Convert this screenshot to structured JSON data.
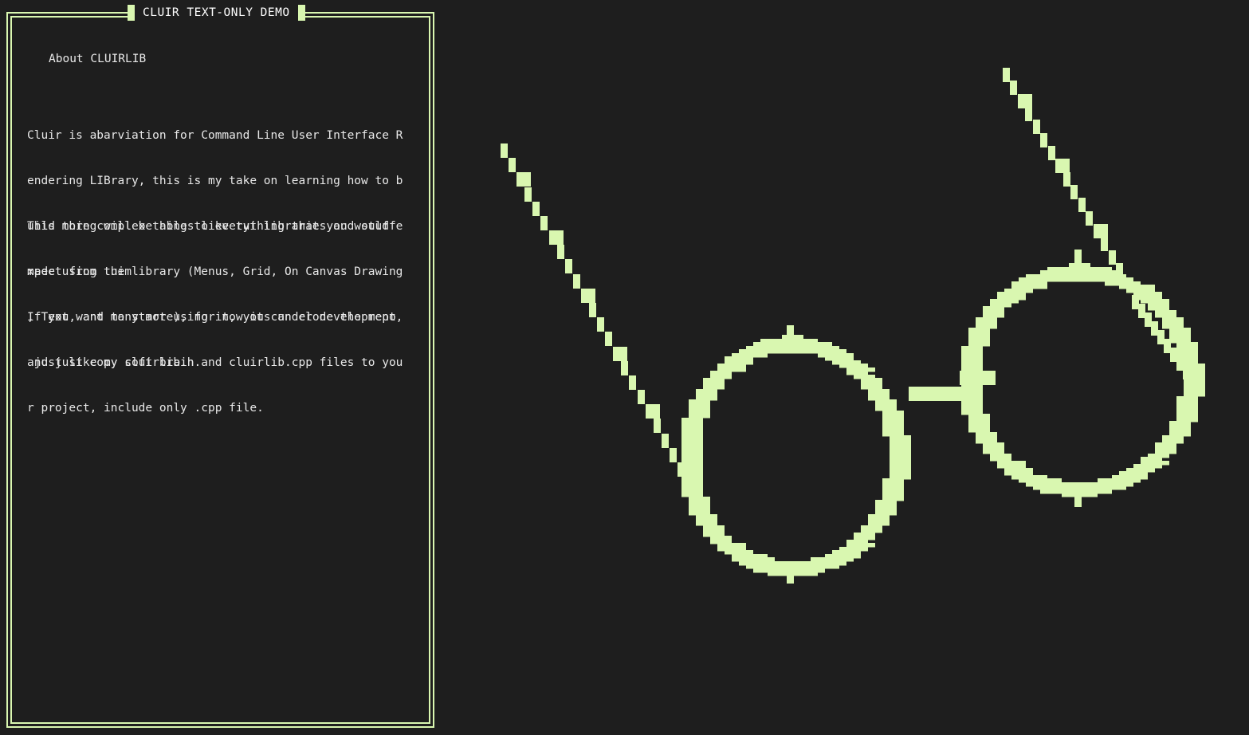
{
  "window": {
    "title": "CLUIR TEXT-ONLY DEMO"
  },
  "content": {
    "heading": "About CLUIRLIB",
    "paragraphs": [
      [
        "Cluir is abarviation for Command Line User Interface R",
        "endering LIBrary, this is my take on learning how to b",
        "uild more complex things like tui libraries and stuff",
        "made using them"
      ],
      [
        "This thing will be able to everything that you would e",
        "xpect from tui library (Menus, Grid, On Canvas Drawing",
        ", Text, and many more), for now its under development,",
        " just like my soft brain."
      ],
      [
        "If you want to start using it, you can clone the repo",
        "and just copy cluirlib.h and cluirlib.cpp files to you",
        "r project, include only .cpp file."
      ]
    ]
  },
  "canvas": {
    "drawing": "glasses-pixel-art",
    "color": "#d9f7b0"
  },
  "colors": {
    "background": "#1e1e1e",
    "accent": "#d9f7b0",
    "text": "#e8e8e8"
  }
}
